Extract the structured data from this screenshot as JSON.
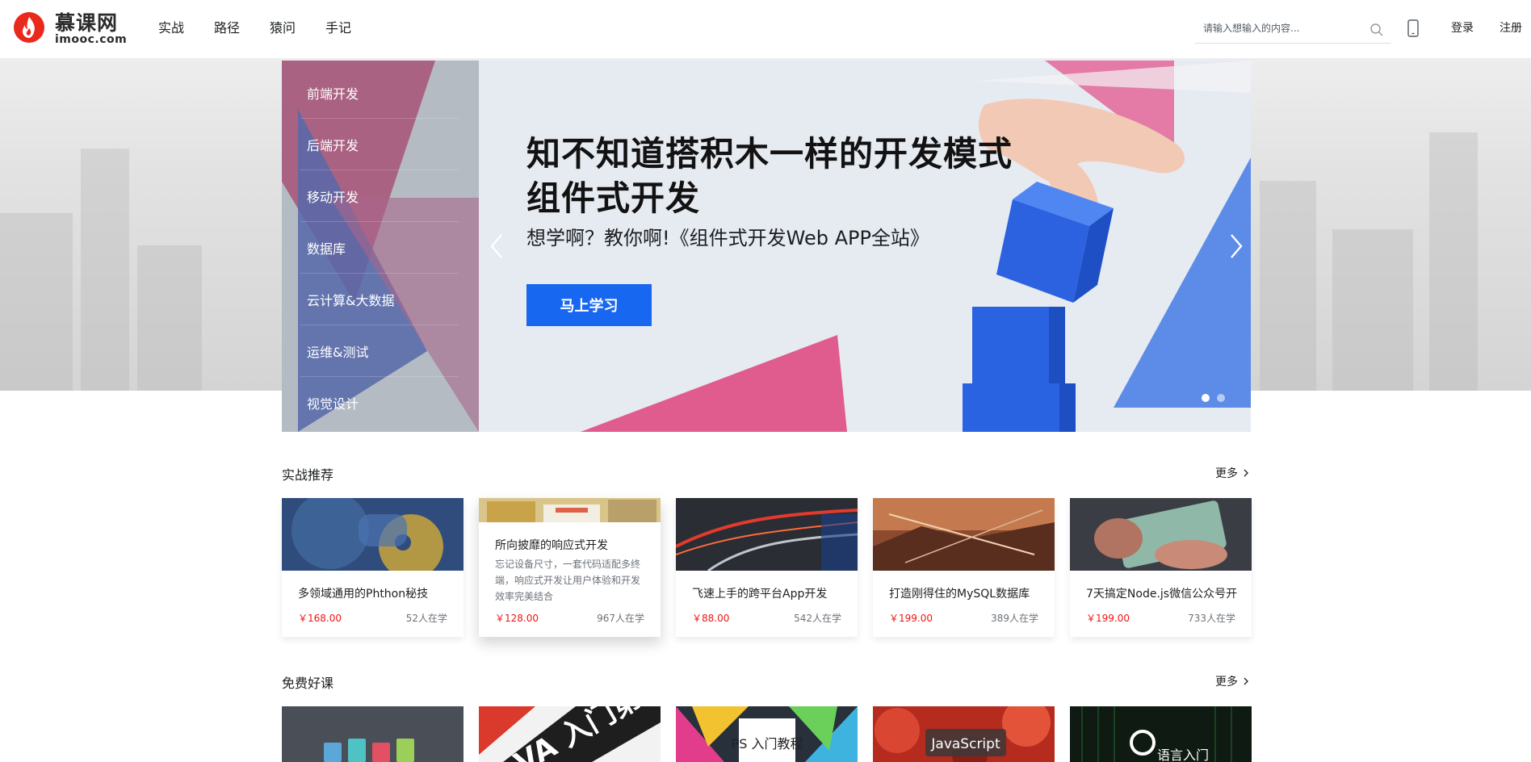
{
  "header": {
    "logo": {
      "cn": "慕课网",
      "en": "imooc.com"
    },
    "nav": [
      "实战",
      "路径",
      "猿问",
      "手记"
    ],
    "search_placeholder": "请输入想输入的内容...",
    "login": "登录",
    "register": "注册"
  },
  "banner": {
    "categories": [
      "前端开发",
      "后端开发",
      "移动开发",
      "数据库",
      "云计算&大数据",
      "运维&测试",
      "视觉设计"
    ],
    "headline_line1": "知不知道搭积木一样的开发模式",
    "headline_line2": "组件式开发",
    "subline": "想学啊？教你啊!《组件式开发Web APP全站》",
    "cta": "马上学习",
    "slide_count": 2,
    "active_slide": 1
  },
  "practice": {
    "title": "实战推荐",
    "more": "更多",
    "courses": [
      {
        "title": "多领域通用的Phthon秘技",
        "price": "￥168.00",
        "students": "52人在学"
      },
      {
        "title": "所向披靡的响应式开发",
        "desc": "忘记设备尺寸，一套代码适配多终端，响应式开发让用户体验和开发效率完美结合",
        "price": "￥128.00",
        "students": "967人在学"
      },
      {
        "title": "飞速上手的跨平台App开发",
        "price": "￥88.00",
        "students": "542人在学"
      },
      {
        "title": "打造刚得住的MySQL数据库",
        "price": "￥199.00",
        "students": "389人在学"
      },
      {
        "title": "7天搞定Node.js微信公众号开",
        "price": "￥199.00",
        "students": "733人在学"
      }
    ]
  },
  "free": {
    "title": "免费好课",
    "more": "更多",
    "thumbs": [
      "",
      "VA 入门第一季",
      "PS 入门教程",
      "JavaScript",
      "语言入门"
    ]
  },
  "colors": {
    "accent": "#1867f0",
    "price": "#f01414",
    "logo_red": "#e8291c"
  }
}
